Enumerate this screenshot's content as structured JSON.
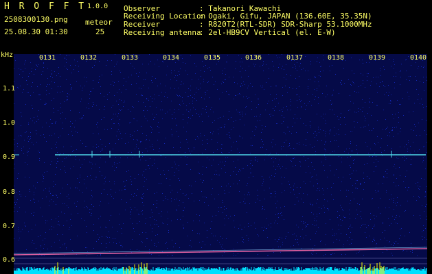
{
  "header": {
    "app_name": "H R O F F T",
    "version": "1.0.0",
    "filename": "2508300130.png",
    "datetime": "25.08.30 01:30",
    "meteor_label": "meteor",
    "meteor_count": "25",
    "info": [
      {
        "label": "Observer",
        "value": ": Takanori Kawachi"
      },
      {
        "label": "Receiving Location",
        "value": ": Ogaki, Gifu, JAPAN (136.60E, 35.35N)"
      },
      {
        "label": "Receiver",
        "value": ": R820T2(RTL-SDR) SDR-Sharp 53.1000MHz"
      },
      {
        "label": "Receiving antenna",
        "value": ": 2el-HB9CV Vertical (el. E-W)"
      }
    ]
  },
  "spectrogram": {
    "y_unit": "kHz",
    "y_ticks": [
      "1.1",
      "1.0",
      "0.9",
      "0.8",
      "0.7",
      "0.6"
    ],
    "time_ticks": [
      "0131",
      "0132",
      "0133",
      "0134",
      "0135",
      "0136",
      "0137",
      "0138",
      "0139",
      "0140"
    ],
    "colors": {
      "background": "#050a48",
      "noise": "#1d3cff",
      "carrier": "#4fd8e8",
      "baseline": "#e060a0",
      "level": "#00e0ff",
      "level_peak": "#ffff00",
      "tick_text": "#ffff66"
    }
  }
}
